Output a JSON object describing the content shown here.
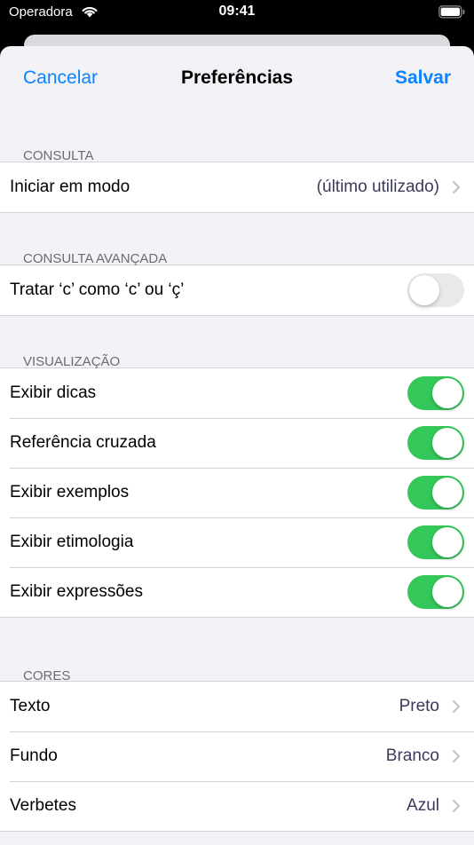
{
  "status_bar": {
    "carrier": "Operadora",
    "time": "09:41"
  },
  "nav": {
    "cancel": "Cancelar",
    "title": "Preferências",
    "save": "Salvar"
  },
  "sections": {
    "consulta": {
      "header": "CONSULTA",
      "rows": [
        {
          "label": "Iniciar em modo",
          "value": "(último utilizado)"
        }
      ]
    },
    "avancada": {
      "header": "CONSULTA AVANÇADA",
      "rows": [
        {
          "label": "Tratar ‘c’ como ‘c’ ou ‘ç’",
          "on": false
        }
      ]
    },
    "visualizacao": {
      "header": "VISUALIZAÇÃO",
      "rows": [
        {
          "label": "Exibir dicas",
          "on": true
        },
        {
          "label": "Referência cruzada",
          "on": true
        },
        {
          "label": "Exibir exemplos",
          "on": true
        },
        {
          "label": "Exibir etimologia",
          "on": true
        },
        {
          "label": "Exibir expressões",
          "on": true
        }
      ]
    },
    "cores": {
      "header": "CORES",
      "rows": [
        {
          "label": "Texto",
          "value": "Preto"
        },
        {
          "label": "Fundo",
          "value": "Branco"
        },
        {
          "label": "Verbetes",
          "value": "Azul"
        }
      ]
    }
  },
  "colors": {
    "accent": "#0a84ff",
    "toggle_on": "#34c759",
    "toggle_off": "#e9e9eb"
  }
}
